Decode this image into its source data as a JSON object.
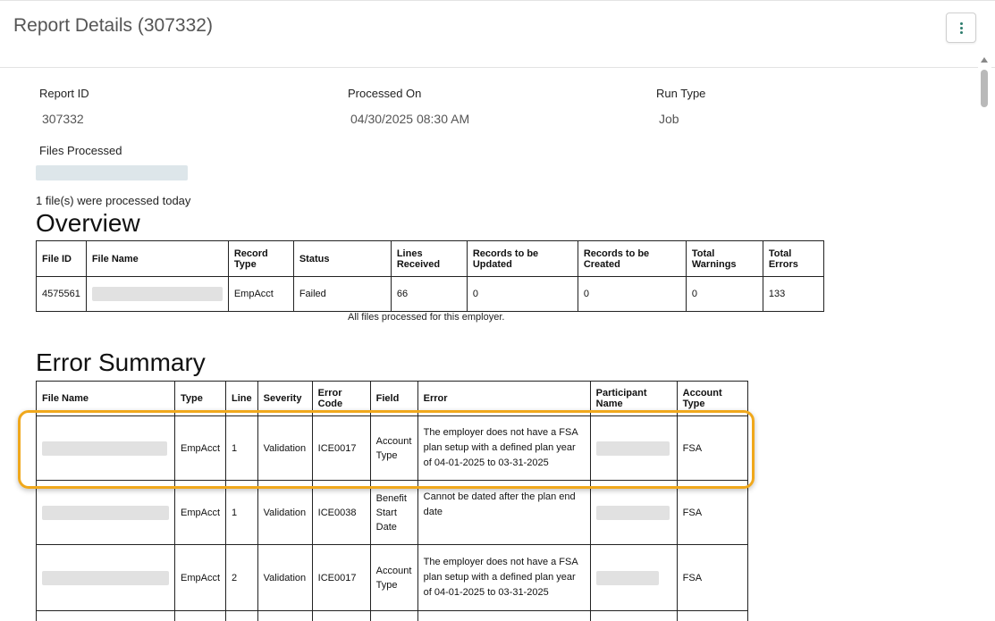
{
  "header": {
    "title": "Report Details (307332)",
    "menu_icon": "kebab-menu-icon"
  },
  "meta": {
    "report_id_label": "Report ID",
    "report_id_value": "307332",
    "processed_on_label": "Processed On",
    "processed_on_value": "04/30/2025 08:30 AM",
    "run_type_label": "Run Type",
    "run_type_value": "Job",
    "files_processed_label": "Files Processed",
    "files_note": "1 file(s) were processed today"
  },
  "overview": {
    "title": "Overview",
    "columns": [
      "File ID",
      "File Name",
      "Record Type",
      "Status",
      "Lines Received",
      "Records to be Updated",
      "Records to be Created",
      "Total Warnings",
      "Total Errors"
    ],
    "row": {
      "file_id": "4575561",
      "record_type": "EmpAcct",
      "status": "Failed",
      "lines_received": "66",
      "records_updated": "0",
      "records_created": "0",
      "total_warnings": "0",
      "total_errors": "133"
    },
    "caption": "All files processed for this employer."
  },
  "error_summary": {
    "title": "Error Summary",
    "columns": [
      "File Name",
      "Type",
      "Line",
      "Severity",
      "Error Code",
      "Field",
      "Error",
      "Participant Name",
      "Account Type"
    ],
    "rows": [
      {
        "type": "EmpAcct",
        "line": "1",
        "severity": "Validation",
        "code": "ICE0017",
        "field": "Account Type",
        "error": "The employer does not have a FSA plan setup with a defined plan year of 04-01-2025 to 03-31-2025",
        "account_type": "FSA"
      },
      {
        "type": "EmpAcct",
        "line": "1",
        "severity": "Validation",
        "code": "ICE0038",
        "field": "Benefit Start Date",
        "error": "Cannot be dated after the plan end date",
        "account_type": "FSA"
      },
      {
        "type": "EmpAcct",
        "line": "2",
        "severity": "Validation",
        "code": "ICE0017",
        "field": "Account Type",
        "error": "The employer does not have a FSA plan setup with a defined plan year of 04-01-2025 to 03-31-2025",
        "account_type": "FSA"
      }
    ]
  },
  "colors": {
    "highlight": "#f0a81c",
    "accent": "#2e7d6e"
  }
}
